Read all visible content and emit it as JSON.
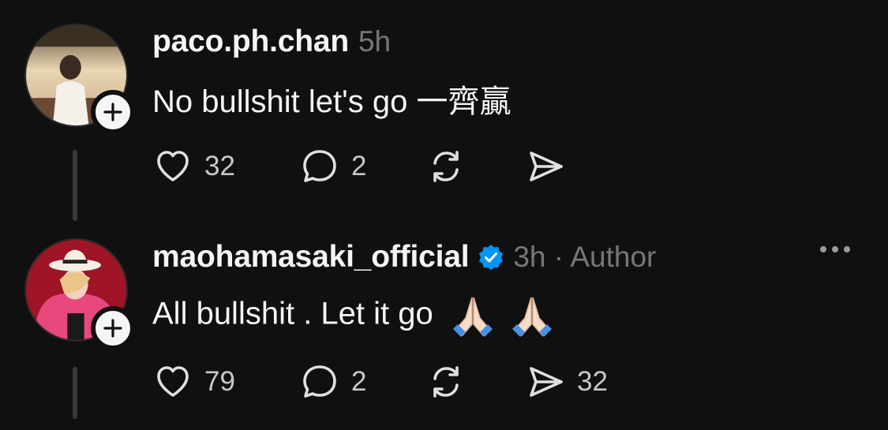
{
  "posts": [
    {
      "username": "paco.ph.chan",
      "meta": "5h",
      "verified": false,
      "text": "No bullshit let's go 一齊贏",
      "likes": "32",
      "replies": "2",
      "shares": ""
    },
    {
      "username": "maohamasaki_official",
      "meta": "3h · Author",
      "verified": true,
      "text": "All bullshit . Let it go",
      "emoji": "folded-hands-icon x2",
      "likes": "79",
      "replies": "2",
      "shares": "32"
    }
  ],
  "colors": {
    "background": "#101010",
    "text": "#f3f5f7",
    "muted": "#777777",
    "verified": "#0095f6"
  }
}
